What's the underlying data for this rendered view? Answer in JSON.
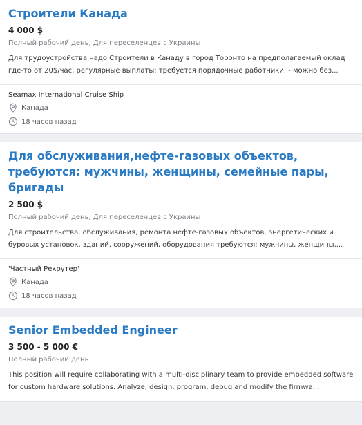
{
  "listings": [
    {
      "title": "Строители Канада",
      "salary": "4 000 $",
      "meta": "Полный рабочий день, Для переселенцев с Украины",
      "description": "Для трудоустройства надо Строители в Канаду в город Торонто на предполагаемый оклад где-то от 20$/час, регулярные выплаты; требуется порядочные работники, - можно без...",
      "company": "Seamax International Cruise Ship",
      "location": "Канада",
      "posted": "18 часов назад"
    },
    {
      "title": "Для обслуживания,нефте-газовых объектов, требуются: мужчины, женщины, семейные пары, бригады",
      "salary": "2 500 $",
      "meta": "Полный рабочий день, Для переселенцев с Украины",
      "description": "Для строительства, обслуживания, ремонта нефте-газовых объектов, энергетических и буровых установок, зданий, сооружений, оборудования требуются: мужчины, женщины,...",
      "company": "'Частный Рекрутер'",
      "location": "Канада",
      "posted": "18 часов назад"
    },
    {
      "title": "Senior Embedded Engineer",
      "salary": "3 500 - 5 000 €",
      "meta": "Полный рабочий день",
      "description": "This position will require collaborating with a multi-disciplinary team to provide embedded software for custom hardware solutions. Analyze, design, program, debug and modify the firmwa..."
    }
  ],
  "icons": {
    "location": "map-pin-icon",
    "time": "clock-icon"
  },
  "colors": {
    "title": "#2a7bc4",
    "background": "#eef0f3"
  }
}
